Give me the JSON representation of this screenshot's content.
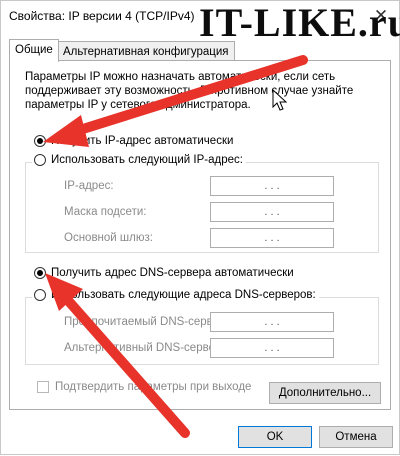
{
  "window": {
    "title": "Свойства: IP версии 4 (TCP/IPv4)",
    "close_glyph": "✕",
    "watermark": "IT-LIKE.ru"
  },
  "tabs": [
    {
      "label": "Общие",
      "active": true
    },
    {
      "label": "Альтернативная конфигурация",
      "active": false
    }
  ],
  "description": "Параметры IP можно назначать автоматически, если сеть поддерживает эту возможность. В противном случае узнайте параметры IP у сетевого администратора.",
  "ip": {
    "auto_label": "Получить IP-адрес автоматически",
    "manual_label": "Использовать следующий IP-адрес:",
    "selected": "auto",
    "fields": [
      {
        "label": "IP-адрес:",
        "value": ".   .   ."
      },
      {
        "label": "Маска подсети:",
        "value": ".   .   ."
      },
      {
        "label": "Основной шлюз:",
        "value": ".   .   ."
      }
    ]
  },
  "dns": {
    "auto_label": "Получить адрес DNS-сервера автоматически",
    "manual_label": "Использовать следующие адреса DNS-серверов:",
    "selected": "auto",
    "fields": [
      {
        "label": "Предпочитаемый DNS-сервер:",
        "value": ".   .   ."
      },
      {
        "label": "Альтернативный DNS-сервер:",
        "value": ".   .   ."
      }
    ]
  },
  "validate_label": "Подтвердить параметры при выходе",
  "buttons": {
    "advanced": "Дополнительно...",
    "ok": "OK",
    "cancel": "Отмена"
  },
  "colors": {
    "arrow": "#e8332a",
    "accent_border": "#0078d7",
    "disabled_text": "#8a8a8a"
  }
}
